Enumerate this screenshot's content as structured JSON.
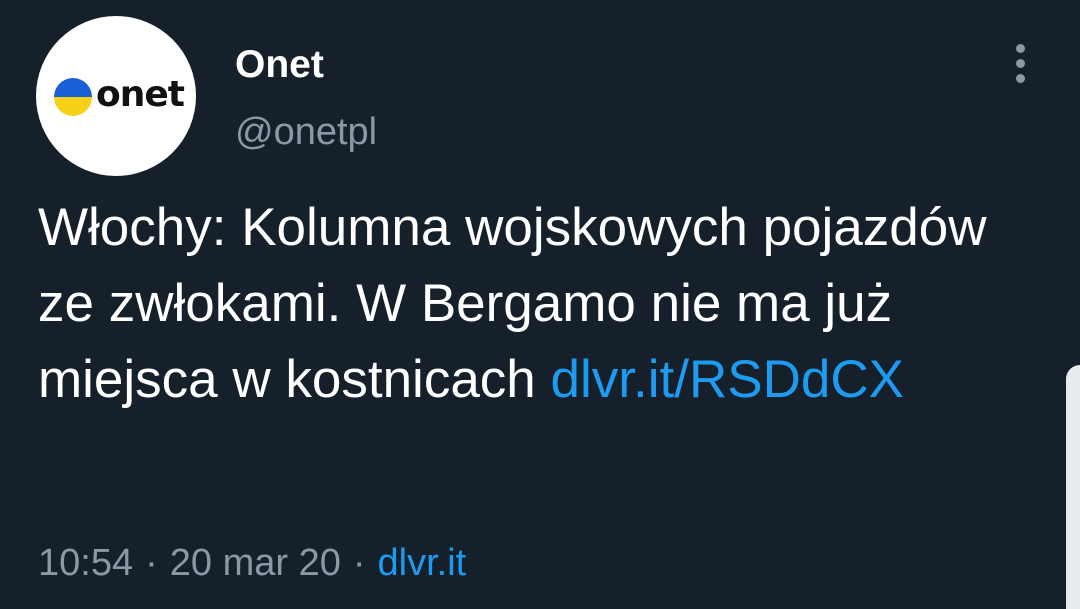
{
  "account": {
    "name": "Onet",
    "handle": "@onetpl",
    "avatar_logo_text": "onet",
    "avatar_flag_colors": {
      "top": "#1a5fd6",
      "bottom": "#f7d117"
    }
  },
  "menu": {
    "icon": "more-vertical-icon"
  },
  "tweet": {
    "text": "Włochy: Kolumna wojskowych pojazdów ze zwłokami. W Bergamo nie ma już miejsca w kostnicach",
    "link": "dlvr.it/RSDdCX"
  },
  "meta": {
    "time": "10:54",
    "separator": "·",
    "date": "20 mar 20",
    "source": "dlvr.it"
  },
  "colors": {
    "background": "#15202b",
    "text": "#ffffff",
    "secondary": "#8b98a5",
    "link": "#1d9bf0"
  }
}
